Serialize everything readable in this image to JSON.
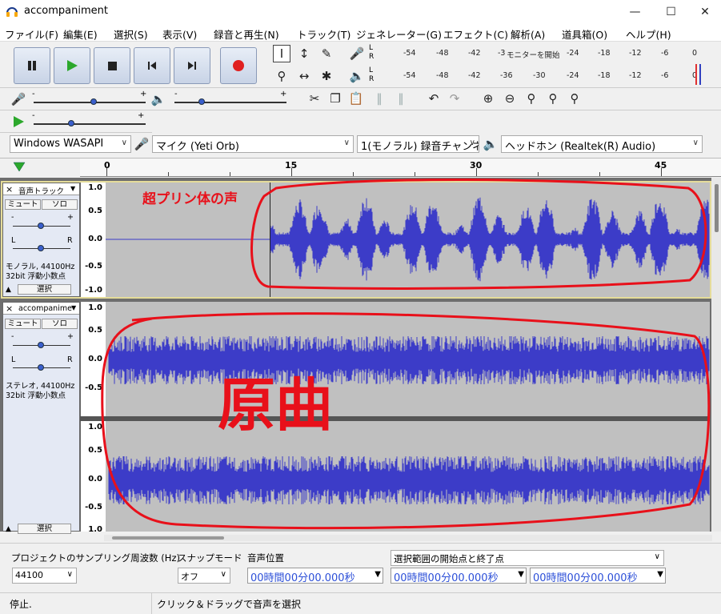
{
  "window": {
    "title": "accompaniment"
  },
  "menu": [
    "ファイル(F)",
    "編集(E)",
    "選択(S)",
    "表示(V)",
    "録音と再生(N)",
    "トラック(T)",
    "ジェネレーター(G)",
    "エフェクト(C)",
    "解析(A)",
    "道具箱(O)",
    "ヘルプ(H)"
  ],
  "meters": {
    "record": {
      "left": "L",
      "right": "R",
      "ticks": [
        "-54",
        "-48",
        "-42",
        "-3",
        "モニターを開始",
        "-24",
        "-18",
        "-12",
        "-6",
        "0"
      ]
    },
    "play": {
      "left": "L",
      "right": "R",
      "ticks": [
        "-54",
        "-48",
        "-42",
        "-36",
        "-30",
        "-24",
        "-18",
        "-12",
        "-6",
        "0"
      ]
    }
  },
  "slider_signs": {
    "minus": "-",
    "plus": "+"
  },
  "device": {
    "host": "Windows WASAPI",
    "mic": "マイク (Yeti Orb)",
    "channels": "1(モノラル) 録音チャンネ",
    "output": "ヘッドホン (Realtek(R) Audio)"
  },
  "ruler": {
    "labels": [
      "0",
      "15",
      "30",
      "45"
    ]
  },
  "track1": {
    "name": "音声トラック",
    "close": "×",
    "mute": "ミュート",
    "solo": "ソロ",
    "minus": "-",
    "plus": "+",
    "left": "L",
    "right": "R",
    "info1": "モノラル, 44100Hz",
    "info2": "32bit 浮動小数点",
    "select": "選択",
    "collapse": "▲",
    "scale": [
      "1.0",
      "0.5",
      "0.0",
      "-0.5",
      "-1.0"
    ],
    "annotation": "超プリン体の声"
  },
  "track2": {
    "name": "accompanime",
    "close": "×",
    "mute": "ミュート",
    "solo": "ソロ",
    "minus": "-",
    "plus": "+",
    "left": "L",
    "right": "R",
    "info1": "ステレオ, 44100Hz",
    "info2": "32bit 浮動小数点",
    "select": "選択",
    "collapse": "▲",
    "scale_top": [
      "1.0",
      "0.5",
      "0.0",
      "-0.5"
    ],
    "scale_bottom": [
      "1.0",
      "0.5",
      "0.0",
      "-0.5",
      "1.0"
    ],
    "annotation": "原曲"
  },
  "bottom": {
    "rate_label": "プロジェクトのサンプリング周波数 (Hz)",
    "rate_value": "44100",
    "snap_label": "スナップモード",
    "snap_value": "オフ",
    "pos_label": "音声位置",
    "pos_value": "00時間00分00.000秒",
    "sel_label": "選択範囲の開始点と終了点",
    "sel_start": "00時間00分00.000秒",
    "sel_end": "00時間00分00.000秒"
  },
  "status": {
    "left": "停止.",
    "right": "クリック＆ドラッグで音声を選択"
  },
  "colors": {
    "wave": "#3c3cc8",
    "annotation": "#e8101a",
    "track_bg": "#c0c0c0"
  }
}
